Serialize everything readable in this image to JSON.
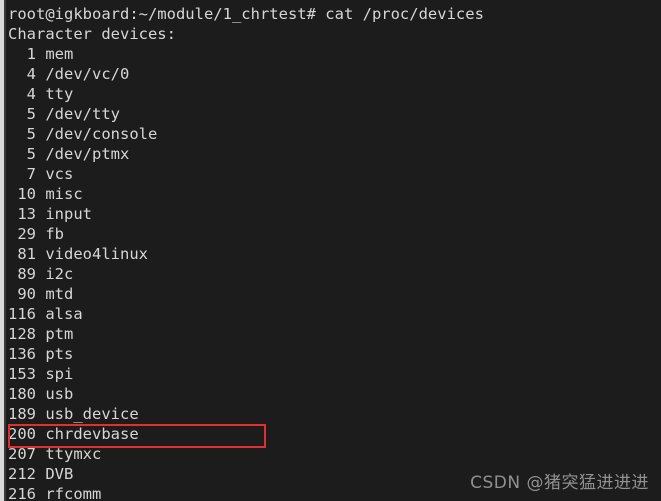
{
  "terminal": {
    "background_color": "#1c1c1c",
    "text_color": "#d6d6d6",
    "prompt_line": "root@igkboard:~/module/1_chrtest# cat /proc/devices",
    "output_header": "Character devices:",
    "devices": [
      {
        "major": "1",
        "name": "mem"
      },
      {
        "major": "4",
        "name": "/dev/vc/0"
      },
      {
        "major": "4",
        "name": "tty"
      },
      {
        "major": "5",
        "name": "/dev/tty"
      },
      {
        "major": "5",
        "name": "/dev/console"
      },
      {
        "major": "5",
        "name": "/dev/ptmx"
      },
      {
        "major": "7",
        "name": "vcs"
      },
      {
        "major": "10",
        "name": "misc"
      },
      {
        "major": "13",
        "name": "input"
      },
      {
        "major": "29",
        "name": "fb"
      },
      {
        "major": "81",
        "name": "video4linux"
      },
      {
        "major": "89",
        "name": "i2c"
      },
      {
        "major": "90",
        "name": "mtd"
      },
      {
        "major": "116",
        "name": "alsa"
      },
      {
        "major": "128",
        "name": "ptm"
      },
      {
        "major": "136",
        "name": "pts"
      },
      {
        "major": "153",
        "name": "spi"
      },
      {
        "major": "180",
        "name": "usb"
      },
      {
        "major": "189",
        "name": "usb_device"
      },
      {
        "major": "200",
        "name": "chrdevbase"
      },
      {
        "major": "207",
        "name": "ttymxc"
      },
      {
        "major": "212",
        "name": "DVB"
      },
      {
        "major": "216",
        "name": "rfcomm"
      }
    ],
    "lines": [
      "root@igkboard:~/module/1_chrtest# cat /proc/devices",
      "Character devices:",
      "  1 mem",
      "  4 /dev/vc/0",
      "  4 tty",
      "  5 /dev/tty",
      "  5 /dev/console",
      "  5 /dev/ptmx",
      "  7 vcs",
      " 10 misc",
      " 13 input",
      " 29 fb",
      " 81 video4linux",
      " 89 i2c",
      " 90 mtd",
      "116 alsa",
      "128 ptm",
      "136 pts",
      "153 spi",
      "180 usb",
      "189 usb_device",
      "200 chrdevbase",
      "207 ttymxc",
      "212 DVB",
      "216 rfcomm"
    ]
  },
  "annotation": {
    "highlight_color": "#e03030",
    "highlighted_line": "200 chrdevbase"
  },
  "watermark": {
    "text": "CSDN @猪突猛进进进",
    "color": "#9a9a9a"
  }
}
